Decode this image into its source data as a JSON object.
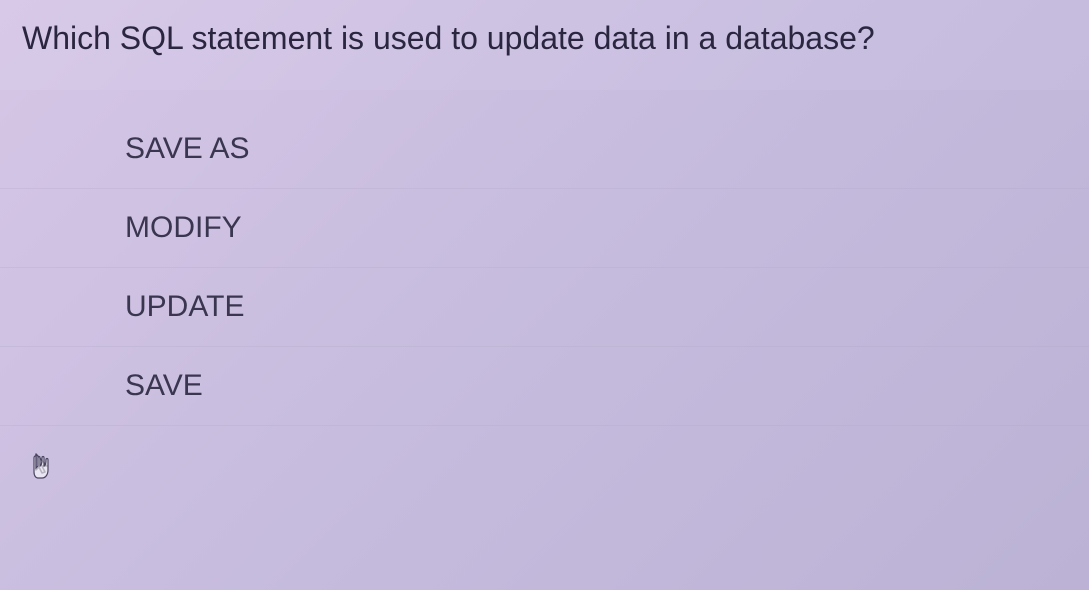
{
  "quiz": {
    "question": "Which SQL statement is used to update data in a database?",
    "options": [
      {
        "label": "SAVE AS"
      },
      {
        "label": "MODIFY"
      },
      {
        "label": "UPDATE"
      },
      {
        "label": "SAVE"
      }
    ]
  }
}
